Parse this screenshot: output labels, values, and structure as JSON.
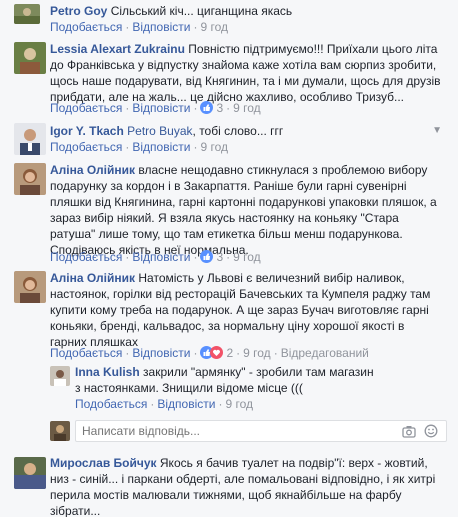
{
  "comments": [
    {
      "author": "Petro Goy",
      "text": "Сільський кіч... циганщина якась",
      "like": "Подобається",
      "reply": "Відповісти",
      "time": "9 год"
    },
    {
      "author": "Lessia Alexart Zukrainu",
      "text": "Повністю підтримуємо!!! Приїхали цього літа до Франківська у відпустку знайома каже хотіла вам сюрпиз зробити, щось наше подарувати, від Княгинин, та і ми думали, щось для друзів прибдати, але на жаль... це дійсно жахливо, особливо Тризуб...",
      "like": "Подобається",
      "reply": "Відповісти",
      "reactions": "3",
      "time": "9 год"
    },
    {
      "author": "Igor Y. Tkach",
      "mention": "Petro Buyak",
      "text": ", тобі слово... ггг",
      "like": "Подобається",
      "reply": "Відповісти",
      "time": "9 год"
    },
    {
      "author": "Аліна Олійник",
      "text": "власне нещодавно стикнулася з проблемою вибору подарунку за кордон і в Закарпаття. Раніше були гарні сувенірні пляшки від Княгинина, гарні картонні подарункові упаковки пляшок, а зараз вибір ніякий. Я взяла якусь настоянку на коньяку \"Стара ратуша\" лише тому, що там етикетка більш менш подарункова. Сподіваюсь якість в неї нормальна.",
      "like": "Подобається",
      "reply": "Відповісти",
      "reactions": "3",
      "time": "9 год"
    },
    {
      "author": "Аліна Олійник",
      "text": "Натомість у Львові є величезний вибір наливок, настоянок, горілки від ресторацій Бачевських та Кумпеля раджу там купити кому треба на подарунок. А ще зараз Бучач виготовляє гарні коньяки, бренді, кальвадос, за нормальну ціну хорошої якості в гарних пляшках",
      "like": "Подобається",
      "reply": "Відповісти",
      "reactions": "2",
      "time": "9 год",
      "edited": "Відредагований"
    }
  ],
  "reply_comment": {
    "author": "Inna Kulish",
    "text": "закрили \"армянку\" - зробили там магазин з настоянками. Знищили відоме місце (((",
    "like": "Подобається",
    "reply": "Відповісти",
    "time": "9 год"
  },
  "reply_box": {
    "placeholder": "Написати відповідь..."
  },
  "last_comment": {
    "author": "Мирослав Бойчук",
    "text": "Якось я бачив туалет на подвір\"ї: верх - жовтий, низ - синій... і паркани обдерті, але помальовані відповідно, і як хитрі перила мостів малювали тижнями, щоб якнайбільше на фарбу зібрати..."
  },
  "colors": {
    "link": "#365899",
    "action": "#4267b2",
    "muted": "#90949c",
    "like_blue": "#5890ff",
    "love_red": "#f25268"
  }
}
